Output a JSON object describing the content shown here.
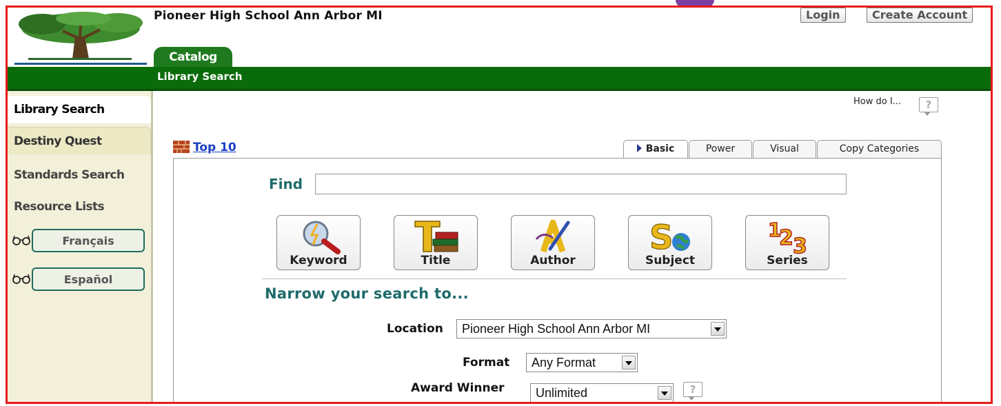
{
  "header": {
    "school_name": "Pioneer High School Ann Arbor MI",
    "login_label": "Login",
    "create_account_label": "Create Account",
    "catalog_tab": "Catalog",
    "subnav_label": "Library Search"
  },
  "sidebar": {
    "items": [
      {
        "label": "Library Search",
        "active": true
      },
      {
        "label": "Destiny Quest"
      },
      {
        "label": "Standards Search"
      },
      {
        "label": "Resource Lists"
      }
    ],
    "languages": [
      {
        "label": "Français"
      },
      {
        "label": "Español"
      }
    ]
  },
  "help": {
    "how_do_i": "How do I...",
    "question_mark": "?"
  },
  "top10_label": "Top 10",
  "search_tabs": [
    "Basic",
    "Power",
    "Visual",
    "Copy Categories"
  ],
  "search": {
    "find_label": "Find",
    "find_value": "",
    "buttons": [
      {
        "label": "Keyword",
        "icon": "keyword-magnifier-icon"
      },
      {
        "label": "Title",
        "icon": "title-books-icon"
      },
      {
        "label": "Author",
        "icon": "author-pen-icon"
      },
      {
        "label": "Subject",
        "icon": "subject-globe-icon"
      },
      {
        "label": "Series",
        "icon": "series-123-icon"
      }
    ],
    "narrow_label": "Narrow your search to...",
    "location_label": "Location",
    "location_value": "Pioneer High School Ann Arbor MI",
    "format_label": "Format",
    "format_value": "Any Format",
    "award_label": "Award Winner",
    "award_value": "Unlimited"
  },
  "colors": {
    "frame_border": "#e8191b",
    "nav_green": "#0a6b0a",
    "accent_teal": "#1f6b6b",
    "sidebar_bg": "#f2f0d9",
    "link_blue": "#1a3fc2"
  }
}
